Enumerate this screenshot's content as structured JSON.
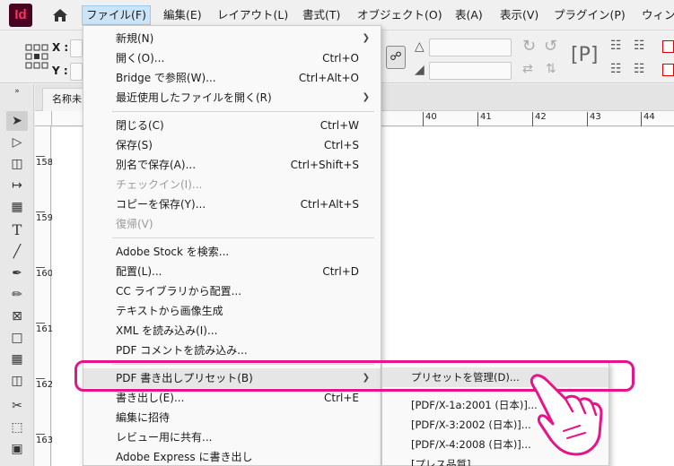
{
  "app": {
    "logo": "Id"
  },
  "menubar": {
    "items": [
      "ファイル(F)",
      "編集(E)",
      "レイアウト(L)",
      "書式(T)",
      "オブジェクト(O)",
      "表(A)",
      "表示(V)",
      "プラグイン(P)",
      "ウィン"
    ],
    "active_index": 0
  },
  "control_panel": {
    "x_label": "X :",
    "y_label": "Y :"
  },
  "document": {
    "tab_title": "名称未",
    "ruler_h": [
      "40",
      "41",
      "42",
      "43",
      "44"
    ],
    "ruler_v": [
      "158",
      "159",
      "160",
      "161",
      "162",
      "163"
    ]
  },
  "file_menu": {
    "items": [
      {
        "label": "新規(N)",
        "shortcut": "",
        "submenu": true,
        "disabled": false
      },
      {
        "label": "開く(O)...",
        "shortcut": "Ctrl+O",
        "submenu": false,
        "disabled": false
      },
      {
        "label": "Bridge で参照(W)...",
        "shortcut": "Ctrl+Alt+O",
        "submenu": false,
        "disabled": false
      },
      {
        "label": "最近使用したファイルを開く(R)",
        "shortcut": "",
        "submenu": true,
        "disabled": false
      },
      {
        "label": "閉じる(C)",
        "shortcut": "Ctrl+W",
        "submenu": false,
        "disabled": false
      },
      {
        "label": "保存(S)",
        "shortcut": "Ctrl+S",
        "submenu": false,
        "disabled": false
      },
      {
        "label": "別名で保存(A)...",
        "shortcut": "Ctrl+Shift+S",
        "submenu": false,
        "disabled": false
      },
      {
        "label": "チェックイン(I)...",
        "shortcut": "",
        "submenu": false,
        "disabled": true
      },
      {
        "label": "コピーを保存(Y)...",
        "shortcut": "Ctrl+Alt+S",
        "submenu": false,
        "disabled": false
      },
      {
        "label": "復帰(V)",
        "shortcut": "",
        "submenu": false,
        "disabled": true
      },
      {
        "label": "Adobe Stock を検索...",
        "shortcut": "",
        "submenu": false,
        "disabled": false
      },
      {
        "label": "配置(L)...",
        "shortcut": "Ctrl+D",
        "submenu": false,
        "disabled": false
      },
      {
        "label": "CC ライブラリから配置...",
        "shortcut": "",
        "submenu": false,
        "disabled": false
      },
      {
        "label": "テキストから画像生成",
        "shortcut": "",
        "submenu": false,
        "disabled": false
      },
      {
        "label": "XML を読み込み(I)...",
        "shortcut": "",
        "submenu": false,
        "disabled": false
      },
      {
        "label": "PDF コメントを読み込み...",
        "shortcut": "",
        "submenu": false,
        "disabled": false
      },
      {
        "label": "PDF 書き出しプリセット(B)",
        "shortcut": "",
        "submenu": true,
        "disabled": false
      },
      {
        "label": "書き出し(E)...",
        "shortcut": "Ctrl+E",
        "submenu": false,
        "disabled": false
      },
      {
        "label": "編集に招待",
        "shortcut": "",
        "submenu": false,
        "disabled": false
      },
      {
        "label": "レビュー用に共有...",
        "shortcut": "",
        "submenu": false,
        "disabled": false
      },
      {
        "label": "Adobe Express に書き出し",
        "shortcut": "",
        "submenu": false,
        "disabled": false
      }
    ],
    "highlighted_index": 16
  },
  "pdf_preset_submenu": {
    "items": [
      "プリセットを管理(D)...",
      "[PDF/X-1a:2001 (日本)]...",
      "[PDF/X-3:2002 (日本)]...",
      "[PDF/X-4:2008 (日本)]...",
      "[プレス品質]..."
    ],
    "highlighted_index": 0
  },
  "colors": {
    "annotation": "#e4148a",
    "logo_bg": "#49021f",
    "logo_fg": "#ff3366"
  }
}
